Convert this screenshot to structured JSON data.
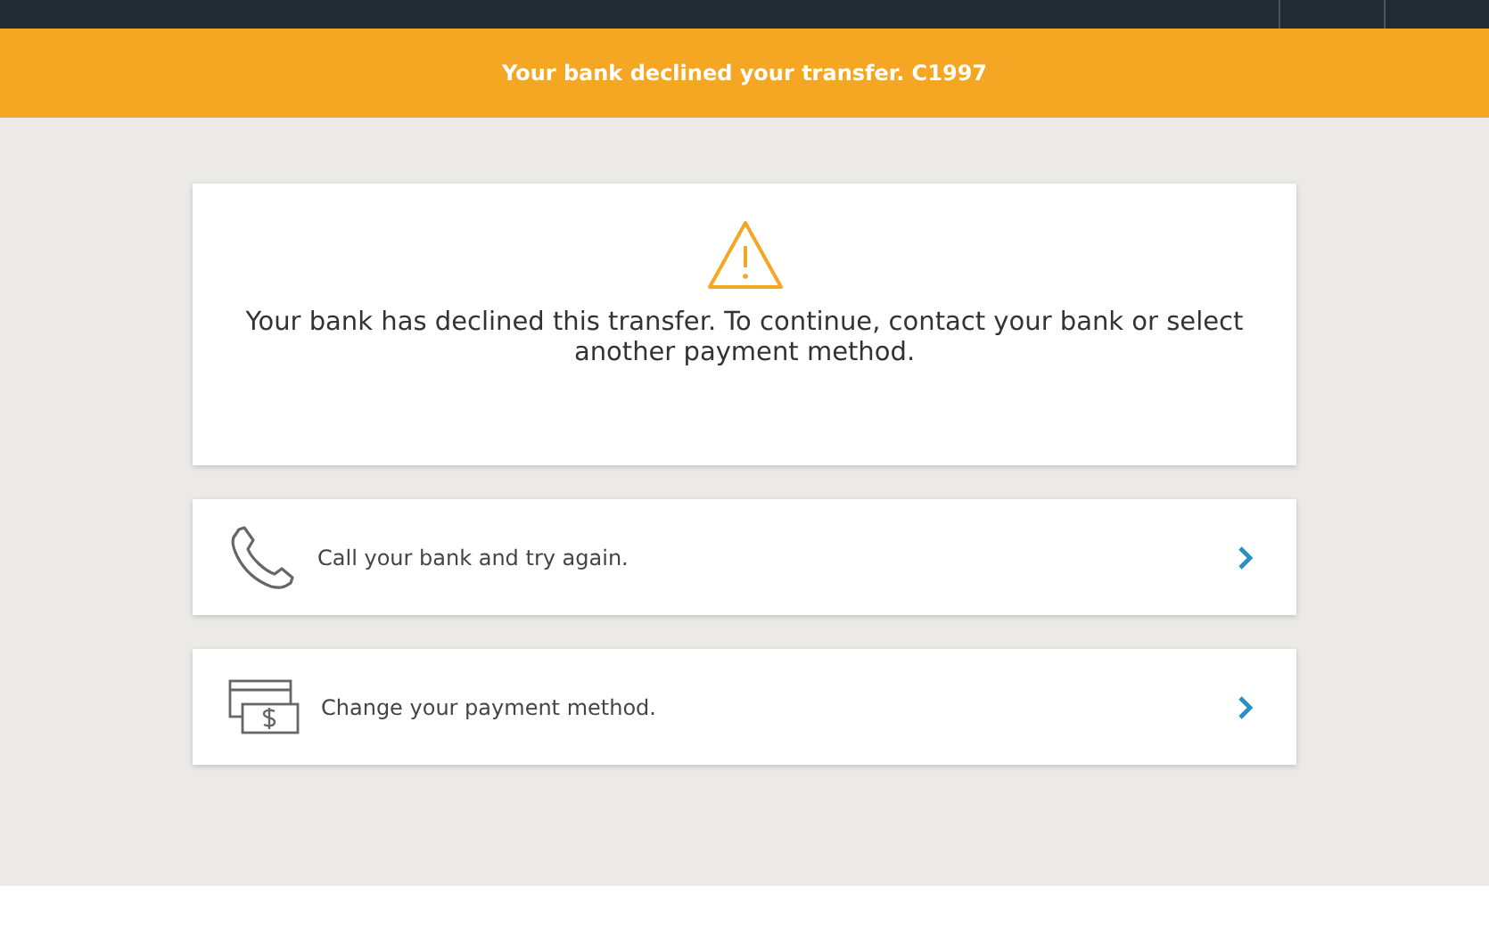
{
  "banner": {
    "message": "Your bank declined your transfer. C1997"
  },
  "notice": {
    "message": "Your bank has declined this transfer. To continue, contact your bank or select another payment method."
  },
  "options": [
    {
      "kind": "phone",
      "label": "Call your bank and try again."
    },
    {
      "kind": "payment",
      "label": "Change your payment method."
    }
  ]
}
